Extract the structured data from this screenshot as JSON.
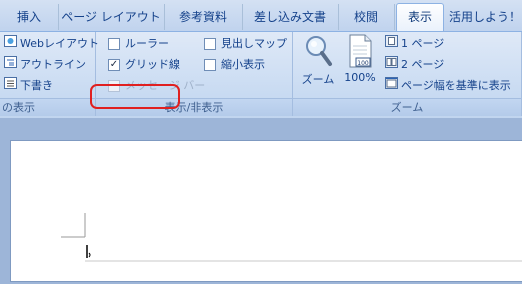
{
  "tabs": [
    {
      "label": "挿入",
      "active": false
    },
    {
      "label": "ページ レイアウト",
      "active": false
    },
    {
      "label": "参考資料",
      "active": false
    },
    {
      "label": "差し込み文書",
      "active": false
    },
    {
      "label": "校閲",
      "active": false
    },
    {
      "label": "表示",
      "active": true
    },
    {
      "label": "活用しよう！",
      "active": false
    }
  ],
  "views_group": {
    "items": [
      "Webレイアウト",
      "アウトライン",
      "下書き"
    ],
    "caption": "の表示"
  },
  "show_hide_group": {
    "ruler": {
      "label": "ルーラー",
      "checked": false
    },
    "gridlines": {
      "label": "グリッド線",
      "checked": true
    },
    "message_bar": {
      "label": "メッセージ バー",
      "checked": false,
      "disabled": true
    },
    "doc_map": {
      "label": "見出しマップ",
      "checked": false
    },
    "thumbnails": {
      "label": "縮小表示",
      "checked": false
    },
    "caption": "表示/非表示"
  },
  "zoom_group": {
    "zoom_label": "ズーム",
    "hundred_label": "100%",
    "hundred_icon_text": "100",
    "one_page": "1 ページ",
    "two_pages": "2 ページ",
    "page_width": "ページ幅を基準に表示",
    "caption": "ズーム"
  },
  "checkmark": "✓"
}
